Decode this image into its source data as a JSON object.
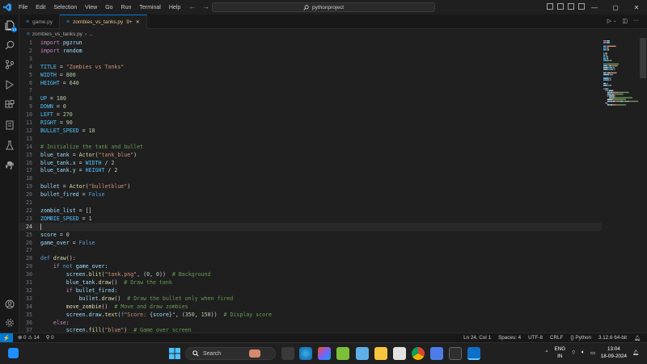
{
  "menu": [
    "File",
    "Edit",
    "Selection",
    "View",
    "Go",
    "Run",
    "Terminal",
    "Help"
  ],
  "search": {
    "label": "pythonproject"
  },
  "window_controls": [
    "—",
    "▢",
    "✕"
  ],
  "activity_badge": "14",
  "tabs": [
    {
      "label": "game.py",
      "active": false,
      "modified": ""
    },
    {
      "label": "zombies_vs_tanks.py",
      "active": true,
      "modified": "9+"
    }
  ],
  "breadcrumb": {
    "file": "zombies_vs_tanks.py",
    "more": "..."
  },
  "code_lines": [
    [
      [
        "kw",
        "import"
      ],
      [
        "op",
        " "
      ],
      [
        "var",
        "pgzrun"
      ]
    ],
    [
      [
        "kw",
        "import"
      ],
      [
        "op",
        " "
      ],
      [
        "var",
        "random"
      ]
    ],
    [],
    [
      [
        "cst",
        "TITLE"
      ],
      [
        "op",
        " = "
      ],
      [
        "str",
        "\"Zombies vs Tanks\""
      ]
    ],
    [
      [
        "cst",
        "WIDTH"
      ],
      [
        "op",
        " = "
      ],
      [
        "num",
        "800"
      ]
    ],
    [
      [
        "cst",
        "HEIGHT"
      ],
      [
        "op",
        " = "
      ],
      [
        "num",
        "640"
      ]
    ],
    [],
    [
      [
        "cst",
        "UP"
      ],
      [
        "op",
        " = "
      ],
      [
        "num",
        "180"
      ]
    ],
    [
      [
        "cst",
        "DOWN"
      ],
      [
        "op",
        " = "
      ],
      [
        "num",
        "0"
      ]
    ],
    [
      [
        "cst",
        "LEFT"
      ],
      [
        "op",
        " = "
      ],
      [
        "num",
        "270"
      ]
    ],
    [
      [
        "cst",
        "RIGHT"
      ],
      [
        "op",
        " = "
      ],
      [
        "num",
        "90"
      ]
    ],
    [
      [
        "cst",
        "BULLET_SPEED"
      ],
      [
        "op",
        " = "
      ],
      [
        "num",
        "10"
      ]
    ],
    [],
    [
      [
        "cmt",
        "# Initialize the tank and bullet"
      ]
    ],
    [
      [
        "var",
        "blue_tank"
      ],
      [
        "op",
        " = "
      ],
      [
        "fn",
        "Actor"
      ],
      [
        "op",
        "("
      ],
      [
        "str",
        "\"tank_blue\""
      ],
      [
        "op",
        ")"
      ]
    ],
    [
      [
        "var",
        "blue_tank"
      ],
      [
        "op",
        "."
      ],
      [
        "var",
        "x"
      ],
      [
        "op",
        " = "
      ],
      [
        "cst",
        "WIDTH"
      ],
      [
        "op",
        " / "
      ],
      [
        "num",
        "2"
      ]
    ],
    [
      [
        "var",
        "blue_tank"
      ],
      [
        "op",
        "."
      ],
      [
        "var",
        "y"
      ],
      [
        "op",
        " = "
      ],
      [
        "cst",
        "HEIGHT"
      ],
      [
        "op",
        " / "
      ],
      [
        "num",
        "2"
      ]
    ],
    [],
    [
      [
        "var",
        "bullet"
      ],
      [
        "op",
        " = "
      ],
      [
        "fn",
        "Actor"
      ],
      [
        "op",
        "("
      ],
      [
        "str",
        "\"bulletblue\""
      ],
      [
        "op",
        ")"
      ]
    ],
    [
      [
        "var",
        "bullet_fired"
      ],
      [
        "op",
        " = "
      ],
      [
        "kw2",
        "False"
      ]
    ],
    [],
    [
      [
        "var",
        "zombie_list"
      ],
      [
        "op",
        " = []"
      ]
    ],
    [
      [
        "cst",
        "ZOMBIE_SPEED"
      ],
      [
        "op",
        " = "
      ],
      [
        "num",
        "1"
      ]
    ],
    [],
    [
      [
        "var",
        "score"
      ],
      [
        "op",
        " = "
      ],
      [
        "num",
        "0"
      ]
    ],
    [
      [
        "var",
        "game_over"
      ],
      [
        "op",
        " = "
      ],
      [
        "kw2",
        "False"
      ]
    ],
    [],
    [
      [
        "kw2",
        "def"
      ],
      [
        "op",
        " "
      ],
      [
        "fn",
        "draw"
      ],
      [
        "op",
        "():"
      ]
    ],
    [
      [
        "op",
        "    "
      ],
      [
        "kw",
        "if"
      ],
      [
        "op",
        " "
      ],
      [
        "kw2",
        "not"
      ],
      [
        "op",
        " "
      ],
      [
        "var",
        "game_over"
      ],
      [
        "op",
        ":"
      ]
    ],
    [
      [
        "op",
        "        "
      ],
      [
        "var",
        "screen"
      ],
      [
        "op",
        "."
      ],
      [
        "fn",
        "blit"
      ],
      [
        "op",
        "("
      ],
      [
        "str",
        "\"tank.png\""
      ],
      [
        "op",
        ", ("
      ],
      [
        "num",
        "0"
      ],
      [
        "op",
        ", "
      ],
      [
        "num",
        "0"
      ],
      [
        "op",
        "))  "
      ],
      [
        "cmt",
        "# Background"
      ]
    ],
    [
      [
        "op",
        "        "
      ],
      [
        "var",
        "blue_tank"
      ],
      [
        "op",
        "."
      ],
      [
        "fn",
        "draw"
      ],
      [
        "op",
        "()  "
      ],
      [
        "cmt",
        "# Draw the tank"
      ]
    ],
    [
      [
        "op",
        "        "
      ],
      [
        "kw",
        "if"
      ],
      [
        "op",
        " "
      ],
      [
        "var",
        "bullet_fired"
      ],
      [
        "op",
        ":"
      ]
    ],
    [
      [
        "op",
        "            "
      ],
      [
        "var",
        "bullet"
      ],
      [
        "op",
        "."
      ],
      [
        "fn",
        "draw"
      ],
      [
        "op",
        "()  "
      ],
      [
        "cmt",
        "# Draw the bullet only when fired"
      ]
    ],
    [
      [
        "op",
        "        "
      ],
      [
        "fn",
        "move_zombie"
      ],
      [
        "op",
        "()  "
      ],
      [
        "cmt",
        "# Move and draw zombies"
      ]
    ],
    [
      [
        "op",
        "        "
      ],
      [
        "var",
        "screen"
      ],
      [
        "op",
        "."
      ],
      [
        "var",
        "draw"
      ],
      [
        "op",
        "."
      ],
      [
        "fn",
        "text"
      ],
      [
        "op",
        "("
      ],
      [
        "kw2",
        "f"
      ],
      [
        "str",
        "\"Score: "
      ],
      [
        "op",
        "{"
      ],
      [
        "var",
        "score"
      ],
      [
        "op",
        "}"
      ],
      [
        "str",
        "\""
      ],
      [
        "op",
        ", ("
      ],
      [
        "num",
        "350"
      ],
      [
        "op",
        ", "
      ],
      [
        "num",
        "150"
      ],
      [
        "op",
        "))  "
      ],
      [
        "cmt",
        "# Display score"
      ]
    ],
    [
      [
        "op",
        "    "
      ],
      [
        "kw",
        "else"
      ],
      [
        "op",
        ":"
      ]
    ],
    [
      [
        "op",
        "        "
      ],
      [
        "var",
        "screen"
      ],
      [
        "op",
        "."
      ],
      [
        "fn",
        "fill"
      ],
      [
        "op",
        "("
      ],
      [
        "str",
        "\"blue\""
      ],
      [
        "op",
        ")  "
      ],
      [
        "cmt",
        "# Game over screen"
      ]
    ]
  ],
  "current_line": 24,
  "status": {
    "errors": "0",
    "warnings": "14",
    "ports": "0",
    "position": "Ln 24, Col 1",
    "spaces": "Spaces: 4",
    "encoding": "UTF-8",
    "eol": "CRLF",
    "language": "Python",
    "interpreter": "3.12.6 64-bit"
  },
  "taskbar": {
    "search_label": "Search",
    "lang_line1": "ENG",
    "lang_line2": "IN",
    "time": "13:04",
    "date": "18-09-2024"
  }
}
